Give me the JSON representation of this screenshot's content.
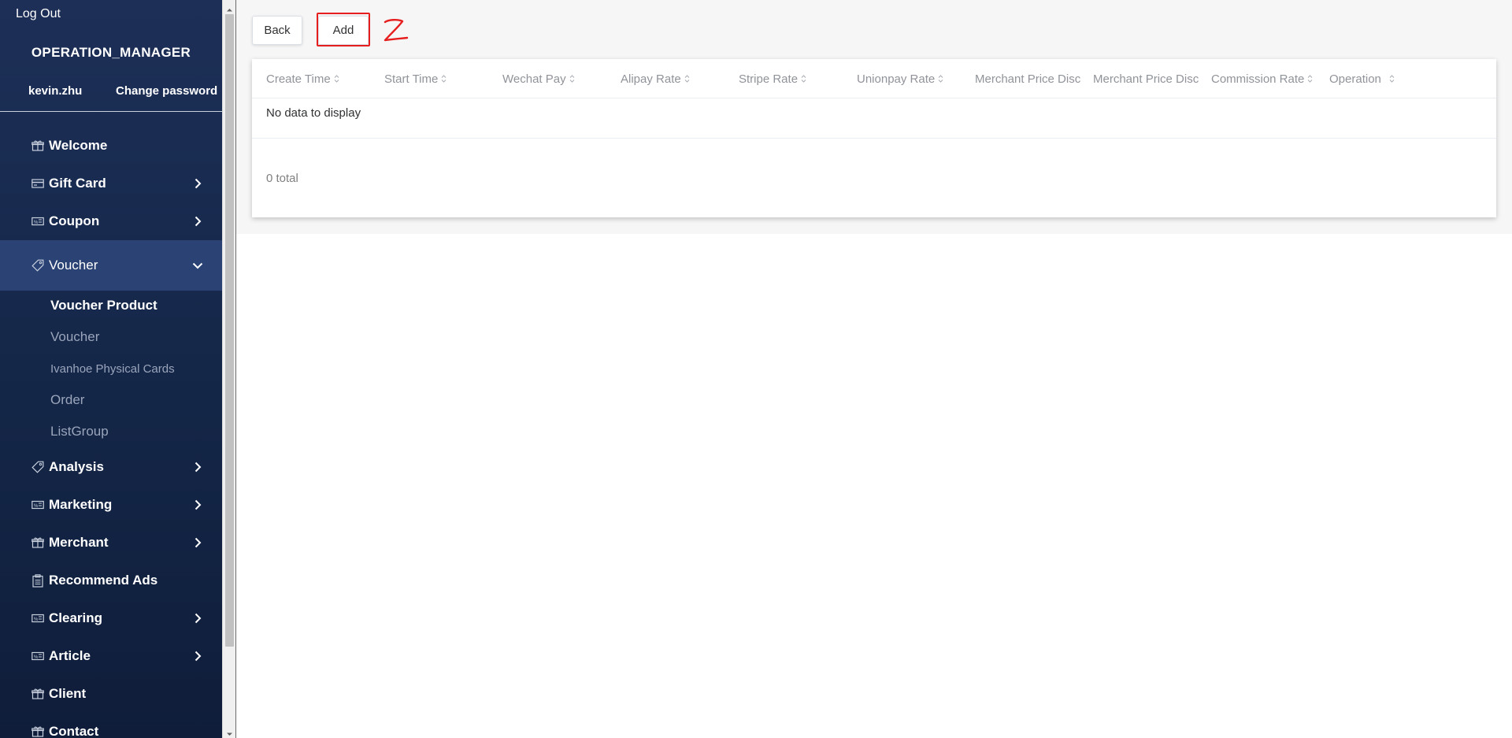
{
  "sidebar": {
    "logout_label": "Log Out",
    "role": "OPERATION_MANAGER",
    "username": "kevin.zhu",
    "change_password_label": "Change password",
    "menu": [
      {
        "label": "Welcome",
        "icon": "gift-box-icon"
      },
      {
        "label": "Gift Card",
        "icon": "card-icon"
      },
      {
        "label": "Coupon",
        "icon": "ticket-icon"
      },
      {
        "label": "Voucher",
        "icon": "tag-icon"
      },
      {
        "label": "Analysis",
        "icon": "tag-icon"
      },
      {
        "label": "Marketing",
        "icon": "ticket-icon"
      },
      {
        "label": "Merchant",
        "icon": "gift-box-icon"
      },
      {
        "label": "Recommend Ads",
        "icon": "clipboard-icon"
      },
      {
        "label": "Clearing",
        "icon": "ticket-icon"
      },
      {
        "label": "Article",
        "icon": "ticket-icon"
      },
      {
        "label": "Client",
        "icon": "gift-box-icon"
      },
      {
        "label": "Contact",
        "icon": "gift-box-icon"
      }
    ],
    "voucher_submenu": [
      {
        "label": "Voucher Product"
      },
      {
        "label": "Voucher"
      },
      {
        "label": "Ivanhoe Physical Cards"
      },
      {
        "label": "Order"
      },
      {
        "label": "ListGroup"
      }
    ]
  },
  "toolbar": {
    "back_label": "Back",
    "add_label": "Add"
  },
  "annotation": {
    "step_number": "2",
    "color": "#e61e1e"
  },
  "table": {
    "columns": [
      {
        "label": "Create Time"
      },
      {
        "label": "Start Time"
      },
      {
        "label": "Wechat Pay"
      },
      {
        "label": "Alipay Rate"
      },
      {
        "label": "Stripe Rate"
      },
      {
        "label": "Unionpay Rate"
      },
      {
        "label": "Merchant Price Discount"
      },
      {
        "label": "Merchant Price Discount"
      },
      {
        "label": "Commission Rate"
      },
      {
        "label": "Operation"
      }
    ],
    "empty_text": "No data to display",
    "total_text": "0 total"
  },
  "colors": {
    "sidebar_bg": "#15284a",
    "sidebar_active": "#2a4374",
    "highlight": "#e61e1e"
  }
}
